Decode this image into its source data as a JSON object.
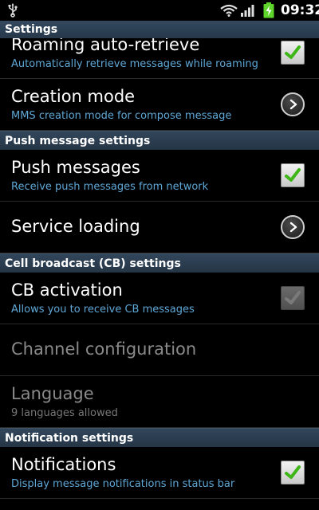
{
  "status_bar": {
    "time": "09:32",
    "icons": [
      "usb-icon",
      "wifi-icon",
      "signal-icon",
      "battery-charging-icon"
    ]
  },
  "title": "Settings",
  "items_top": [
    {
      "title": "Roaming auto-retrieve",
      "subtitle": "Automatically retrieve messages while roaming",
      "control": "checkbox",
      "checked": true
    },
    {
      "title": "Creation mode",
      "subtitle": "MMS creation mode for compose message",
      "control": "arrow"
    }
  ],
  "sections": {
    "push": "Push message settings",
    "cb": "Cell broadcast (CB) settings",
    "notification": "Notification settings"
  },
  "push_items": [
    {
      "title": "Push messages",
      "subtitle": "Receive push messages from network",
      "control": "checkbox",
      "checked": true
    },
    {
      "title": "Service loading",
      "control": "arrow"
    }
  ],
  "cb_items": [
    {
      "title": "CB activation",
      "subtitle": "Allows you to receive CB messages",
      "control": "checkbox",
      "checked": true,
      "disabled": true
    },
    {
      "title": "Channel configuration",
      "disabled": true
    },
    {
      "title": "Language",
      "subtitle": "9 languages allowed",
      "disabled": true
    }
  ],
  "notification_items": [
    {
      "title": "Notifications",
      "subtitle": "Display message notifications in status bar",
      "control": "checkbox",
      "checked": true
    }
  ],
  "colors": {
    "accent_subtitle": "#5ea7d6",
    "check_green": "#3fb618",
    "section_bg": "#2b3d50"
  }
}
